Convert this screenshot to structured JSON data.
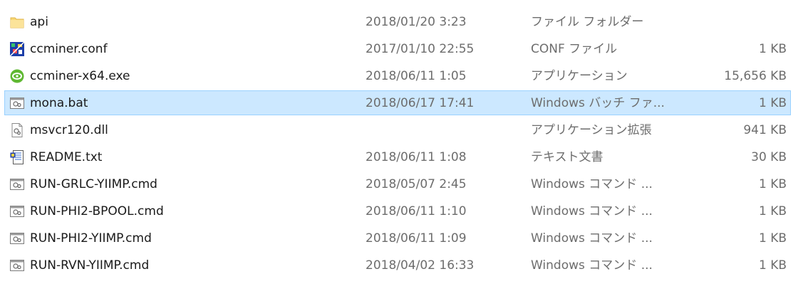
{
  "files": [
    {
      "name": "api",
      "date": "2018/01/20 3:23",
      "type": "ファイル フォルダー",
      "size": "",
      "icon": "folder-icon",
      "selected": false
    },
    {
      "name": "ccminer.conf",
      "date": "2017/01/10 22:55",
      "type": "CONF ファイル",
      "size": "1 KB",
      "icon": "conf-file-icon",
      "selected": false
    },
    {
      "name": "ccminer-x64.exe",
      "date": "2018/06/11 1:05",
      "type": "アプリケーション",
      "size": "15,656 KB",
      "icon": "nvidia-app-icon",
      "selected": false
    },
    {
      "name": "mona.bat",
      "date": "2018/06/17 17:41",
      "type": "Windows バッチ ファ...",
      "size": "1 KB",
      "icon": "batch-file-icon",
      "selected": true
    },
    {
      "name": "msvcr120.dll",
      "date": "",
      "type": "アプリケーション拡張",
      "size": "941 KB",
      "icon": "dll-file-icon",
      "selected": false
    },
    {
      "name": "README.txt",
      "date": "2018/06/11 1:08",
      "type": "テキスト文書",
      "size": "30 KB",
      "icon": "text-file-icon",
      "selected": false
    },
    {
      "name": "RUN-GRLC-YIIMP.cmd",
      "date": "2018/05/07 2:45",
      "type": "Windows コマンド ...",
      "size": "1 KB",
      "icon": "cmd-file-icon",
      "selected": false
    },
    {
      "name": "RUN-PHI2-BPOOL.cmd",
      "date": "2018/06/11 1:10",
      "type": "Windows コマンド ...",
      "size": "1 KB",
      "icon": "cmd-file-icon",
      "selected": false
    },
    {
      "name": "RUN-PHI2-YIIMP.cmd",
      "date": "2018/06/11 1:09",
      "type": "Windows コマンド ...",
      "size": "1 KB",
      "icon": "cmd-file-icon",
      "selected": false
    },
    {
      "name": "RUN-RVN-YIIMP.cmd",
      "date": "2018/04/02 16:33",
      "type": "Windows コマンド ...",
      "size": "1 KB",
      "icon": "cmd-file-icon",
      "selected": false
    }
  ],
  "colors": {
    "selection_bg": "#cce8ff",
    "selection_border": "#99d1ff",
    "name_text": "#1a1a1a",
    "detail_text": "#6d6d6d"
  }
}
